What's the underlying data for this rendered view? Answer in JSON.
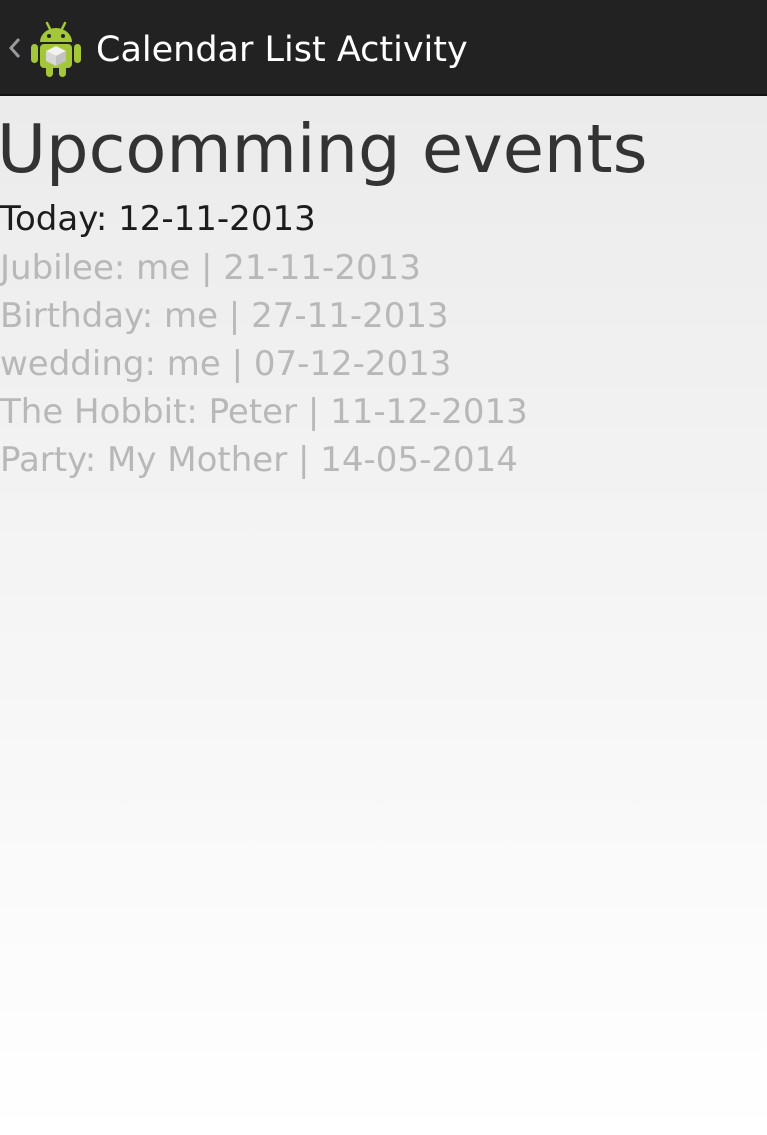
{
  "action_bar": {
    "title": "Calendar List Activity",
    "icon": "android-icon",
    "up_icon": "chevron-left-icon",
    "background": "#222222"
  },
  "main": {
    "heading": "Upcomming events",
    "today": "Today: 12-11-2013",
    "events": [
      "Jubilee: me | 21-11-2013",
      "Birthday: me | 27-11-2013",
      "wedding: me | 07-12-2013",
      "The Hobbit: Peter | 11-12-2013",
      "Party: My Mother | 14-05-2014"
    ]
  },
  "colors": {
    "heading": "#333333",
    "today": "#1c1c1c",
    "event_text": "#b8b8b8",
    "android_green": "#a4c639"
  }
}
